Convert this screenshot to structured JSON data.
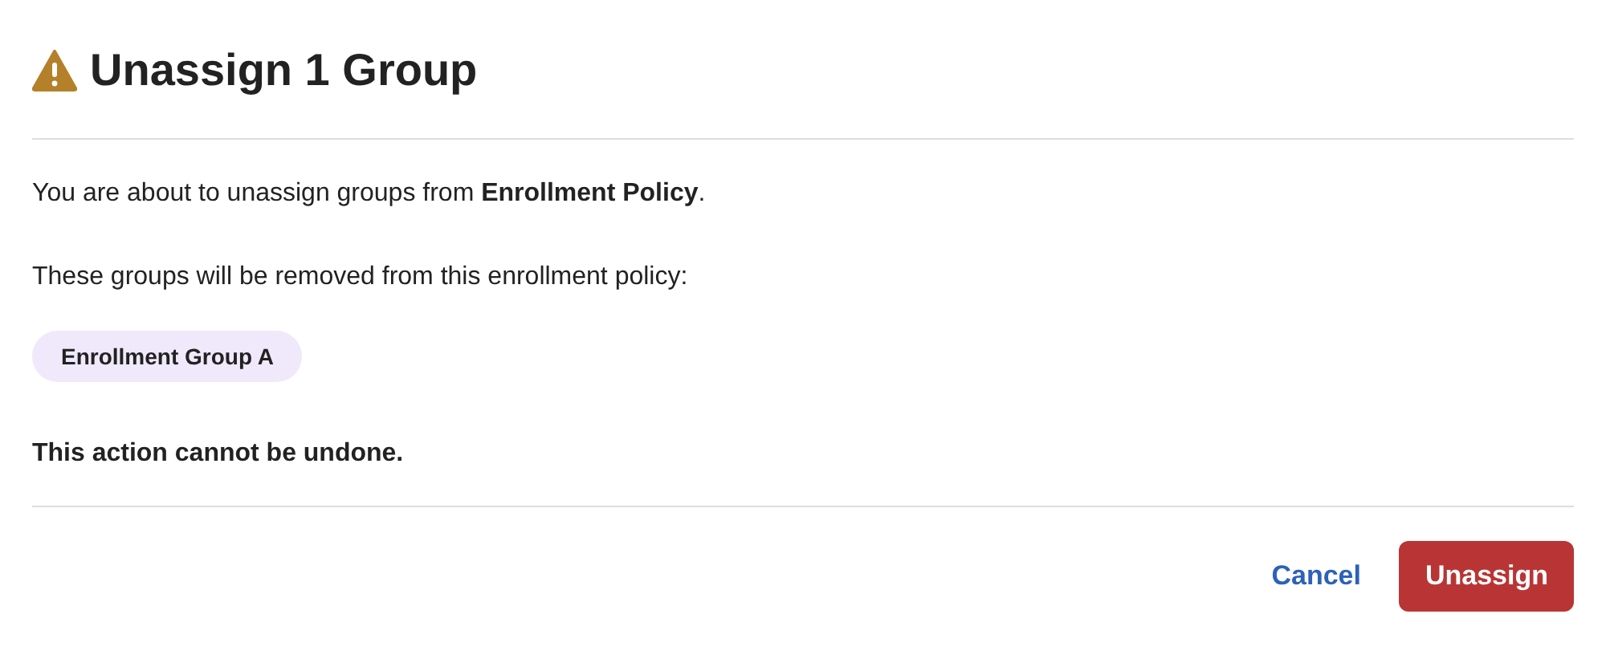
{
  "dialog": {
    "title": "Unassign 1 Group",
    "message": "You are about to unassign groups from **Enrollment Policy**.",
    "list_intro": "These groups will be removed from this enrollment policy:",
    "groups": [
      "Enrollment Group A"
    ],
    "warning": "This action cannot be undone.",
    "buttons": [
      {
        "label": "Cancel",
        "kind": "link"
      },
      {
        "label": "Unassign",
        "kind": "danger"
      }
    ]
  }
}
